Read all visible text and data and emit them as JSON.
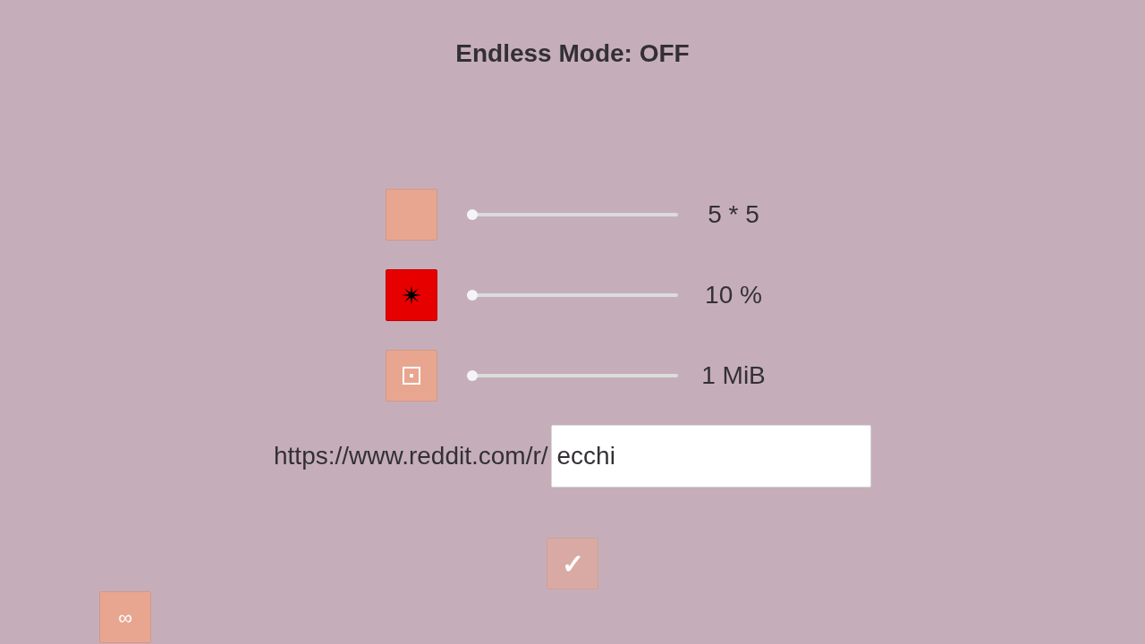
{
  "title": "Endless Mode: OFF",
  "settings": [
    {
      "kind": "blank",
      "active": false,
      "level": 0,
      "reading": "5 * 5"
    },
    {
      "kind": "star",
      "active": true,
      "level": 0,
      "reading": "10 %"
    },
    {
      "kind": "target",
      "active": false,
      "level": 0,
      "reading": "1 MiB"
    }
  ],
  "url": {
    "prefix": "https://www.reddit.com/r/",
    "value": "ecchi"
  },
  "confirm_button": {
    "label": "✓",
    "disabled": true
  },
  "endless_button": {
    "label": "∞"
  }
}
